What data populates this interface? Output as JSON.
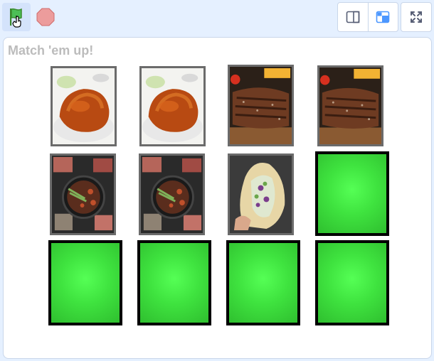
{
  "toolbar": {
    "green_flag": "green-flag-icon",
    "stop": "stop-icon",
    "small_stage": "small-stage-icon",
    "normal_stage": "normal-stage-icon",
    "fullscreen": "fullscreen-icon"
  },
  "stage": {
    "title": "Match 'em up!"
  },
  "cards": [
    {
      "state": "face",
      "image": "roast-duck"
    },
    {
      "state": "face",
      "image": "roast-duck"
    },
    {
      "state": "face",
      "image": "grilled-steak"
    },
    {
      "state": "face",
      "image": "grilled-steak"
    },
    {
      "state": "face",
      "image": "hot-pot-grill"
    },
    {
      "state": "face",
      "image": "hot-pot-grill"
    },
    {
      "state": "face",
      "image": "wrap-sandwich"
    },
    {
      "state": "back",
      "image": ""
    },
    {
      "state": "back",
      "image": ""
    },
    {
      "state": "back",
      "image": ""
    },
    {
      "state": "back",
      "image": ""
    },
    {
      "state": "back",
      "image": ""
    }
  ],
  "colors": {
    "toolbar_bg": "#e5f0ff",
    "card_back": "#44ee44",
    "card_face_border": "#6b6b6b",
    "card_back_border": "#000000",
    "title": "#bcbcbc"
  }
}
